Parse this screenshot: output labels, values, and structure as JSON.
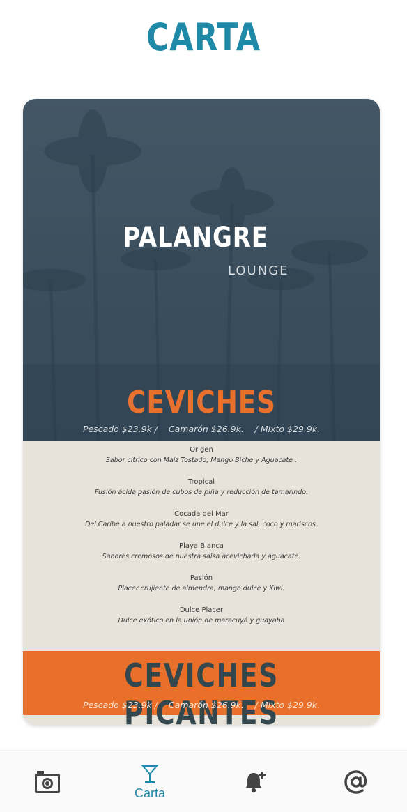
{
  "header": {
    "title": "CARTA"
  },
  "menu": {
    "brand": {
      "name": "PALANGRE",
      "subtitle": "LOUNGE"
    },
    "ceviches": {
      "heading": "CEVICHES",
      "prices": "Pescado $23.9k /    Camarón $26.9k.    / Mixto $29.9k.",
      "items": [
        {
          "name": "Origen",
          "description": "Sabor cítrico con Maíz Tostado, Mango Biche y Aguacate ."
        },
        {
          "name": "Tropical",
          "description": "Fusión ácida pasión de cubos de piña y reducción de tamarindo."
        },
        {
          "name": "Cocada del Mar",
          "description": "Del Caribe a nuestro paladar se une el dulce y la sal, coco y mariscos."
        },
        {
          "name": "Playa Blanca",
          "description": "Sabores cremosos de nuestra salsa acevichada y aguacate."
        },
        {
          "name": "Pasión",
          "description": "Placer crujiente de almendra, mango dulce y Kiwi."
        },
        {
          "name": "Dulce Placer",
          "description": "Dulce exótico en la unión de maracuyá y guayaba"
        }
      ]
    },
    "ceviches_picantes": {
      "heading": "CEVICHES PICANTES",
      "prices": "Pescado $23.9k /    Camarón $26.9k.    / Mixto $29.9k."
    }
  },
  "bottom_nav": {
    "items": [
      {
        "icon": "camera-icon",
        "label": ""
      },
      {
        "icon": "cocktail-icon",
        "label": "Carta",
        "active": true
      },
      {
        "icon": "bell-plus-icon",
        "label": ""
      },
      {
        "icon": "at-sign-icon",
        "label": ""
      }
    ]
  },
  "colors": {
    "accent": "#1f8aa8",
    "orange": "#e8702a",
    "hero_blue": "#3a4e5d",
    "cream": "#e7e2da"
  }
}
